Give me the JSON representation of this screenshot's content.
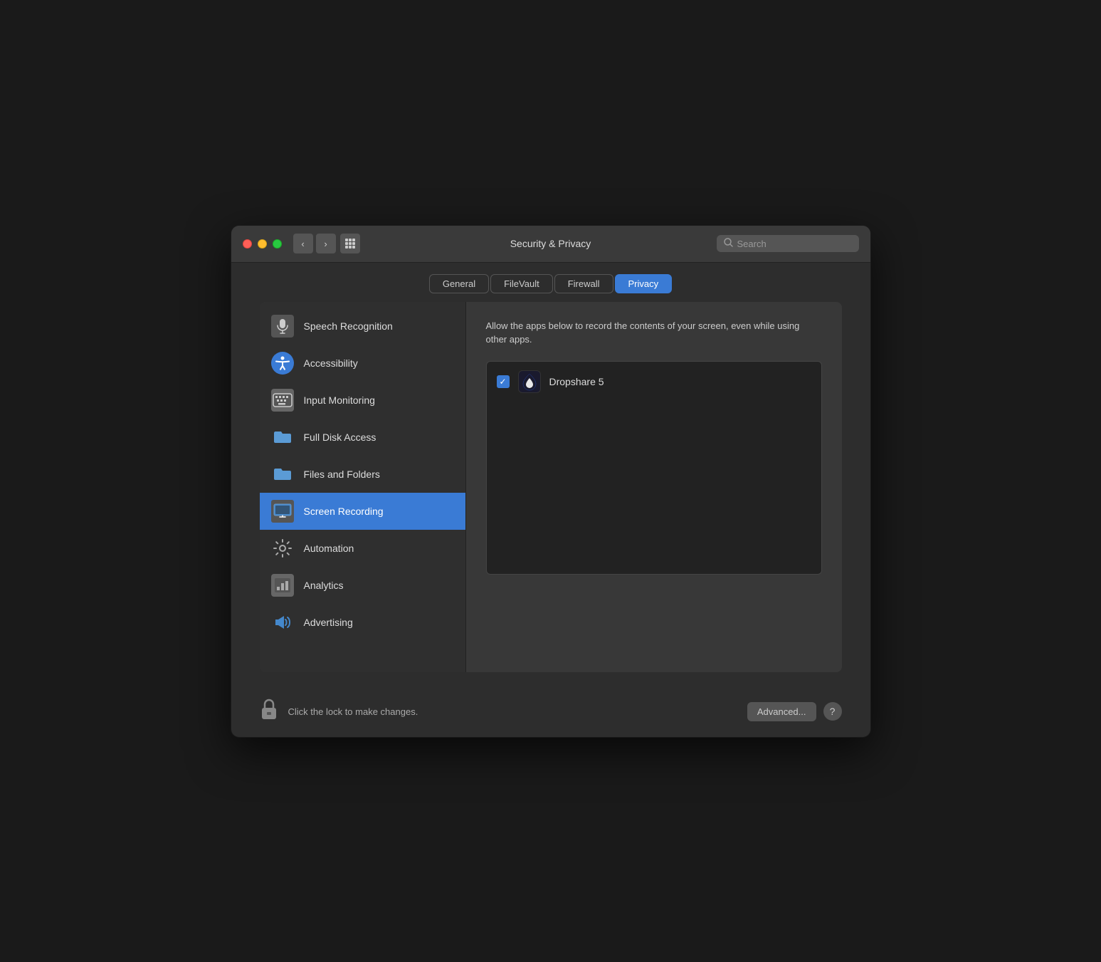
{
  "window": {
    "title": "Security & Privacy",
    "traffic": {
      "close": "close",
      "minimize": "minimize",
      "maximize": "maximize"
    }
  },
  "titlebar": {
    "back_label": "‹",
    "forward_label": "›",
    "grid_label": "⊞",
    "title": "Security & Privacy",
    "search_placeholder": "Search"
  },
  "tabs": [
    {
      "id": "general",
      "label": "General",
      "active": false
    },
    {
      "id": "filevault",
      "label": "FileVault",
      "active": false
    },
    {
      "id": "firewall",
      "label": "Firewall",
      "active": false
    },
    {
      "id": "privacy",
      "label": "Privacy",
      "active": true
    }
  ],
  "sidebar": {
    "items": [
      {
        "id": "speech-recognition",
        "label": "Speech Recognition",
        "icon": "mic-icon",
        "active": false
      },
      {
        "id": "accessibility",
        "label": "Accessibility",
        "icon": "accessibility-icon",
        "active": false
      },
      {
        "id": "input-monitoring",
        "label": "Input Monitoring",
        "icon": "keyboard-icon",
        "active": false
      },
      {
        "id": "full-disk-access",
        "label": "Full Disk Access",
        "icon": "folder-icon",
        "active": false
      },
      {
        "id": "files-and-folders",
        "label": "Files and Folders",
        "icon": "folder-icon",
        "active": false
      },
      {
        "id": "screen-recording",
        "label": "Screen Recording",
        "icon": "monitor-icon",
        "active": true
      },
      {
        "id": "automation",
        "label": "Automation",
        "icon": "gear-icon",
        "active": false
      },
      {
        "id": "analytics",
        "label": "Analytics",
        "icon": "chart-icon",
        "active": false
      },
      {
        "id": "advertising",
        "label": "Advertising",
        "icon": "megaphone-icon",
        "active": false
      }
    ]
  },
  "right_panel": {
    "description": "Allow the apps below to record the contents of your screen, even while using other apps.",
    "apps": [
      {
        "id": "dropshare5",
        "name": "Dropshare 5",
        "checked": true
      }
    ]
  },
  "bottom": {
    "lock_text": "Click the lock to make changes.",
    "advanced_label": "Advanced...",
    "help_label": "?"
  }
}
